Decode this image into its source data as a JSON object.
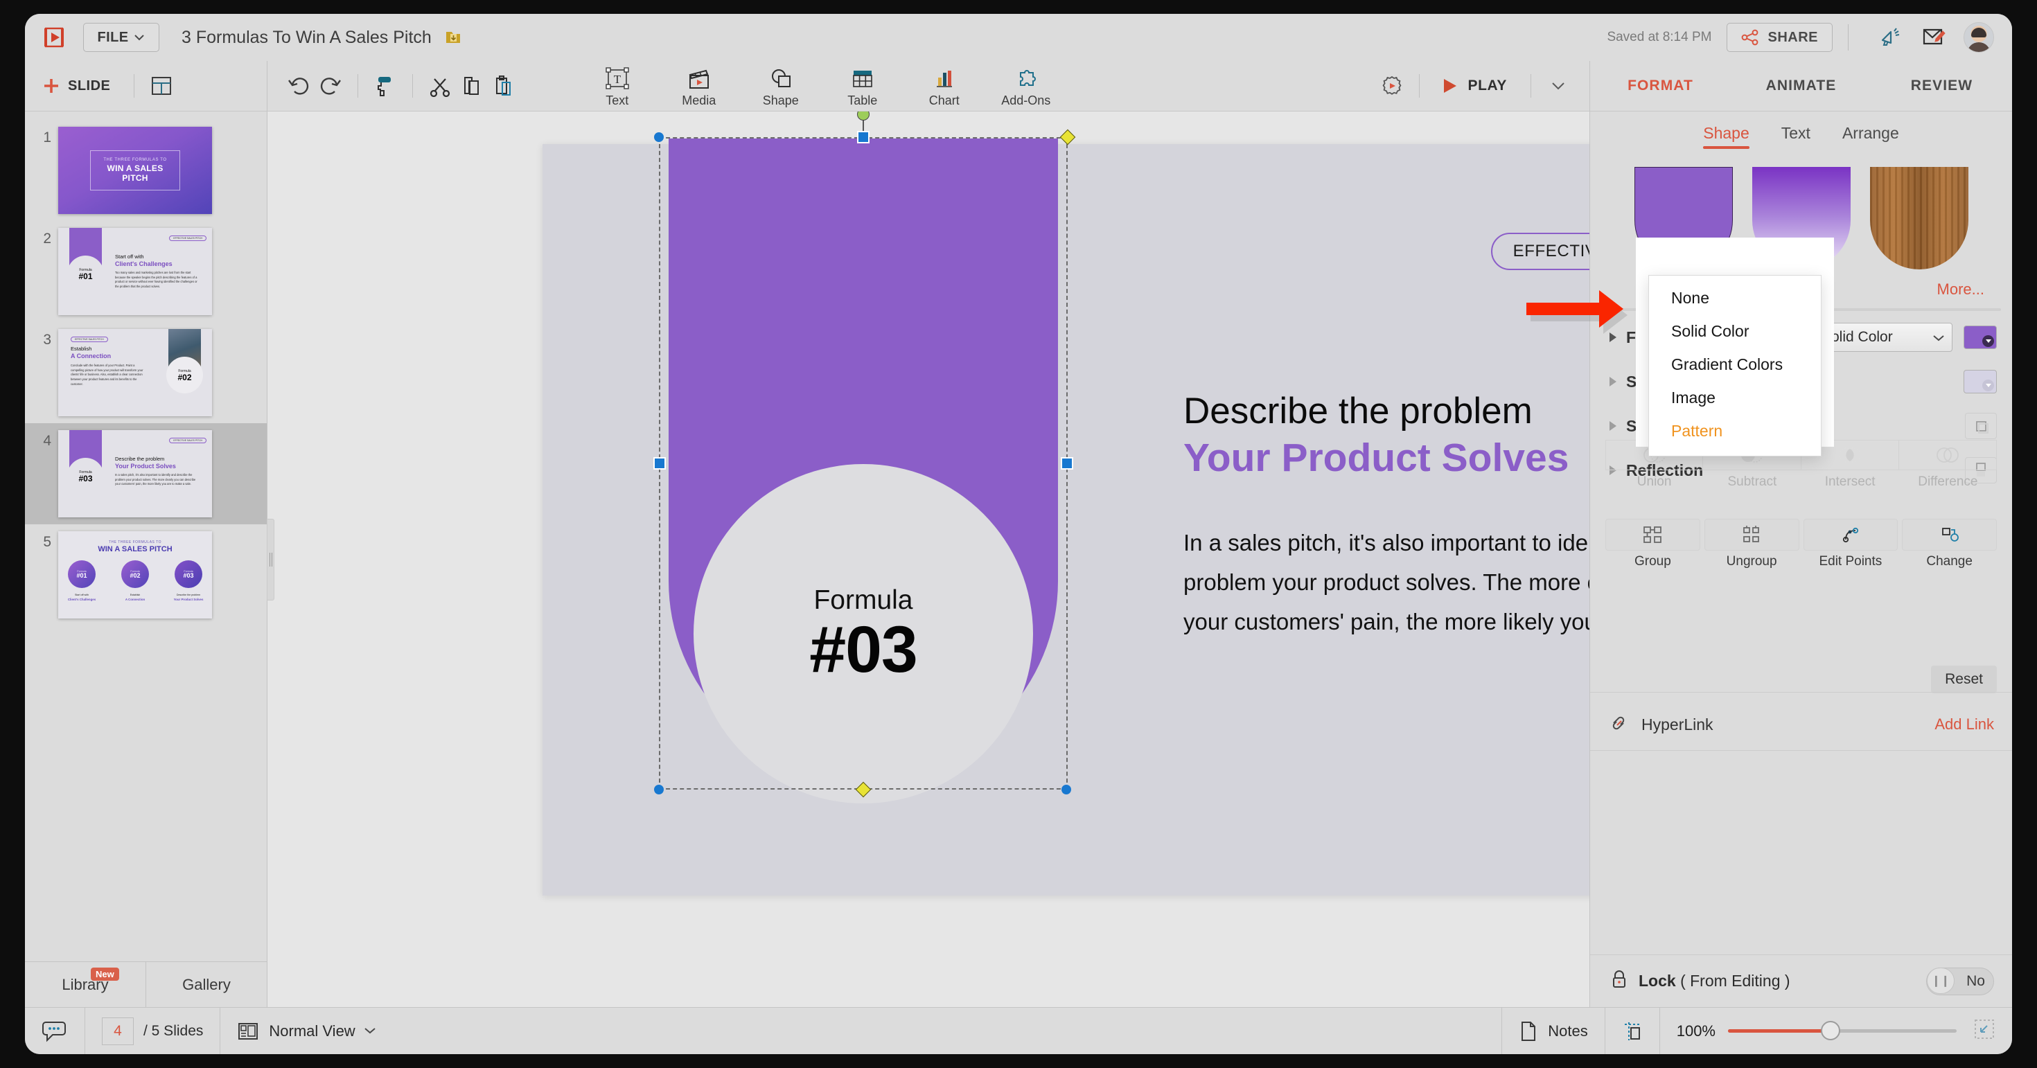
{
  "app": {
    "file_menu": "FILE",
    "document_title": "3 Formulas To Win A Sales Pitch",
    "saved_status": "Saved at 8:14 PM",
    "share_label": "SHARE",
    "accent_red": "#d9553f",
    "brand_purple": "#8b5ec8",
    "highlight_orange": "#f0931f"
  },
  "toolbar": {
    "add_slide_label": "SLIDE",
    "insert_items": [
      {
        "label": "Text",
        "icon": "text-box-icon"
      },
      {
        "label": "Media",
        "icon": "media-clapperboard-icon"
      },
      {
        "label": "Shape",
        "icon": "shape-icon"
      },
      {
        "label": "Table",
        "icon": "table-icon"
      },
      {
        "label": "Chart",
        "icon": "bar-chart-icon"
      },
      {
        "label": "Add-Ons",
        "icon": "puzzle-piece-icon"
      }
    ],
    "play_label": "PLAY"
  },
  "panel_tabs": [
    {
      "label": "FORMAT",
      "active": true
    },
    {
      "label": "ANIMATE",
      "active": false
    },
    {
      "label": "REVIEW",
      "active": false
    }
  ],
  "slides_panel": {
    "slides": [
      {
        "number": "1",
        "kind": "title",
        "eyebrow": "THE THREE FORMULAS TO",
        "title": "WIN A SALES PITCH"
      },
      {
        "number": "2",
        "kind": "formula",
        "badge": "EFFECTIVE SALES PITCH",
        "formula_word": "Formula",
        "formula_num": "#01",
        "heading1": "Start off with",
        "heading2": "Client's Challenges",
        "body": "Too many sales and marketing pitches are lost from the start because the speaker begins the pitch describing the features of a product or service without ever having identified the challenges or the problem that the product solves."
      },
      {
        "number": "3",
        "kind": "photo",
        "badge": "EFFECTIVE SALES PITCH",
        "formula_word": "Formula",
        "formula_num": "#02",
        "heading1": "Establish",
        "heading2": "A Connection",
        "body": "Conclude with the features of your Product. Paint a compelling picture of how your product will transform your clients' life or business. Also, establish a clear connection between your product features and its benefits to the customer."
      },
      {
        "number": "4",
        "kind": "formula",
        "badge": "EFFECTIVE SALES PITCH",
        "formula_word": "Formula",
        "formula_num": "#03",
        "heading1": "Describe the problem",
        "heading2": "Your Product Solves",
        "body": "In a sales pitch, it's also important to identify and describe the problem your product solves. The more clearly you can describe your customers' pain, the more likely you are to make a sale.",
        "selected": true
      },
      {
        "number": "5",
        "kind": "summary",
        "eyebrow": "THE THREE FORMULAS TO",
        "title": "WIN A SALES PITCH",
        "cards": [
          {
            "formula_word": "Formula",
            "formula_num": "#01",
            "cap1": "Start off with",
            "cap2": "Client's Challenges"
          },
          {
            "formula_word": "Formula",
            "formula_num": "#02",
            "cap1": "Establish",
            "cap2": "A Connection"
          },
          {
            "formula_word": "Formula",
            "formula_num": "#03",
            "cap1": "Describe the problem",
            "cap2": "Your Product Solves"
          }
        ]
      }
    ],
    "library_tab": "Library",
    "library_badge": "New",
    "gallery_tab": "Gallery"
  },
  "slide_canvas": {
    "badge": "EFFECTIVE SALES PITCH",
    "formula_word": "Formula",
    "formula_number": "#03",
    "heading_line1": "Describe the problem",
    "heading_line2": "Your Product Solves",
    "body_text": "In a sales pitch, it's also important to identify and describe the problem your product solves. The more clearly you can describe your customers' pain, the more likely you are to make a sale."
  },
  "format_panel": {
    "sub_tabs": [
      {
        "label": "Shape",
        "active": true
      },
      {
        "label": "Text",
        "active": false
      },
      {
        "label": "Arrange",
        "active": false
      }
    ],
    "more_label": "More...",
    "properties": [
      {
        "label": "Fill"
      },
      {
        "label": "Stroke"
      },
      {
        "label": "Shadow"
      },
      {
        "label": "Reflection"
      }
    ],
    "fill_select_value": "Solid Color",
    "fill_dropdown_options": [
      "None",
      "Solid Color",
      "Gradient Colors",
      "Image",
      "Pattern"
    ],
    "fill_dropdown_highlighted": "Pattern",
    "boolean_ops": [
      {
        "label": "Union",
        "icon": "union-icon"
      },
      {
        "label": "Subtract",
        "icon": "subtract-icon"
      },
      {
        "label": "Intersect",
        "icon": "intersect-icon"
      },
      {
        "label": "Difference",
        "icon": "difference-icon"
      }
    ],
    "group_ops": [
      {
        "label": "Group",
        "icon": "group-icon"
      },
      {
        "label": "Ungroup",
        "icon": "ungroup-icon"
      },
      {
        "label": "Edit Points",
        "icon": "edit-points-icon"
      },
      {
        "label": "Change",
        "icon": "change-shape-icon"
      }
    ],
    "reset_label": "Reset",
    "hyperlink_label": "HyperLink",
    "hyperlink_action": "Add Link",
    "lock_label_main": "Lock",
    "lock_label_sub": "( From Editing )",
    "lock_value": "No"
  },
  "status_bar": {
    "current_slide": "4",
    "slide_count_text": "/ 5 Slides",
    "view_mode": "Normal View",
    "notes_label": "Notes",
    "zoom_level": "100%"
  }
}
